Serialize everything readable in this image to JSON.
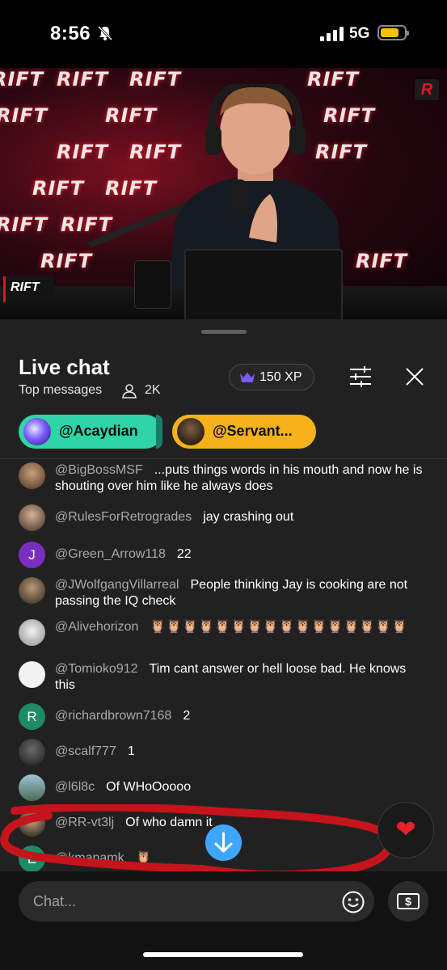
{
  "status_bar": {
    "time": "8:56",
    "network": "5G"
  },
  "video": {
    "overlay_logo": "RIFT",
    "corner_tag": "RIFT",
    "corner_logo": "R",
    "backdrop_words": [
      "RIFT",
      "RIFT",
      "RIFT",
      "RIFT",
      "RIFT",
      "RIFT",
      "RIFT",
      "RIFT",
      "RIFT",
      "RIFT",
      "RIFT",
      "RIFT",
      "RIFT",
      "RIFT",
      "RIFT",
      "RIFT"
    ]
  },
  "chat": {
    "title": "Live chat",
    "mode": "Top messages",
    "viewer_count": "2K",
    "xp": "150 XP",
    "pinned": [
      {
        "name": "@Acaydian"
      },
      {
        "name": "@Servant..."
      }
    ],
    "messages": [
      {
        "user": "@BigBossMSF",
        "text": "...puts things words in his mouth and now he is shouting over him like he always does",
        "avatar": "photo"
      },
      {
        "user": "@RulesForRetrogrades",
        "text": "jay crashing out",
        "avatar": "photo"
      },
      {
        "user": "@Green_Arrow118",
        "text": "22",
        "avatar": "J"
      },
      {
        "user": "@JWolfgangVillarreal",
        "text": "People thinking Jay is cooking are not passing the IQ check",
        "avatar": "photo"
      },
      {
        "user": "@Alivehorizon",
        "text": "🦉🦉🦉🦉🦉🦉🦉🦉🦉🦉🦉🦉🦉🦉🦉🦉",
        "avatar": "photo"
      },
      {
        "user": "@Tomioko912",
        "text": "Tim cant answer or hell loose bad. He knows this",
        "avatar": "photo"
      },
      {
        "user": "@richardbrown7168",
        "text": "2",
        "avatar": "R"
      },
      {
        "user": "@scalf777",
        "text": "1",
        "avatar": "photo"
      },
      {
        "user": "@l6l8c",
        "text": "Of WHoOoooo",
        "avatar": "photo"
      },
      {
        "user": "@RR-vt3lj",
        "text": "Of who damn it",
        "avatar": "photo"
      },
      {
        "user": "@kmanamk",
        "text": "🦉",
        "avatar": "E"
      }
    ],
    "input_placeholder": "Chat...",
    "heart": "❤"
  },
  "colors": {
    "accent_blue": "#3ea6ff",
    "pinned_green": "#2fd4a8",
    "pinned_gold": "#f6b21a",
    "annotation_red": "#c5141c",
    "crown_purple": "#7c5cff"
  }
}
